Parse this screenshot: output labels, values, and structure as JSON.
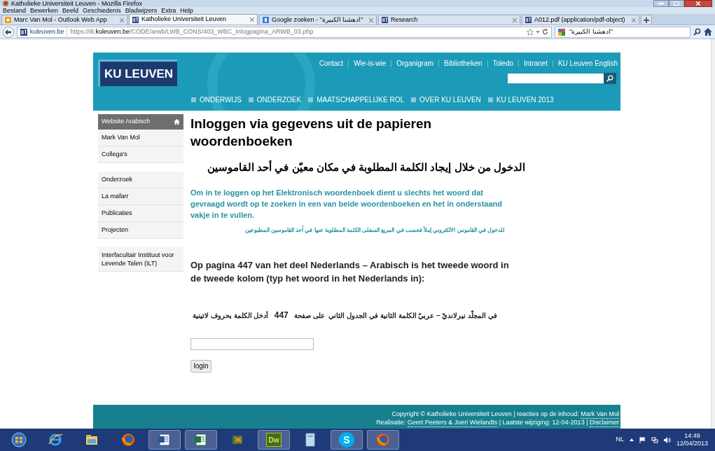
{
  "window": {
    "title": "Katholieke Universiteit Leuven - Mozilla Firefox"
  },
  "menu": [
    "Bestand",
    "Bewerken",
    "Beeld",
    "Geschiedenis",
    "Bladwijzers",
    "Extra",
    "Help"
  ],
  "tabs": [
    {
      "label": "Marc Van Mol - Outlook Web App",
      "selected": false,
      "kind": "outlook"
    },
    {
      "label": "Katholieke Universiteit Leuven",
      "selected": true,
      "kind": "site"
    },
    {
      "label": "\"ادهشنا الكبيرة\" - Google zoeken",
      "selected": false,
      "kind": "google"
    },
    {
      "label": "Research",
      "selected": false,
      "kind": "site"
    },
    {
      "label": "A012.pdf (application/pdf-object)",
      "selected": false,
      "kind": "site"
    }
  ],
  "address": {
    "domain": "kuleuven.be",
    "url_start": "https://ilt.",
    "url_bold": "kuleuven.be",
    "url_rest": "/CODE/arwb/LWB_CONS/403_WBC_Inlogpagina_ARWB_03.php"
  },
  "search": {
    "value": "\"ادهشنا الكبيرة\""
  },
  "header": {
    "logo": "KU LEUVEN",
    "top_links": [
      "Contact",
      "Wie-is-wie",
      "Organigram",
      "Bibliotheken",
      "Toledo",
      "Intranet",
      "KU Leuven English"
    ],
    "nav": [
      "ONDERWIJS",
      "ONDERZOEK",
      "MAATSCHAPPELIJKE ROL",
      "OVER KU LEUVEN",
      "KU LEUVEN 2013"
    ]
  },
  "sidebar": [
    [
      {
        "label": "Website Arabisch",
        "selected": true
      },
      {
        "label": "Mark Van Mol",
        "selected": false
      },
      {
        "label": "Collega's",
        "selected": false
      }
    ],
    [
      {
        "label": "Onderzoek",
        "selected": false
      },
      {
        "label": "La mafarr",
        "selected": false
      },
      {
        "label": "Publicaties",
        "selected": false
      },
      {
        "label": "Projecten",
        "selected": false
      }
    ],
    [
      {
        "label": "Interfacultair Instituut voor Levende Talen (ILT)",
        "selected": false
      }
    ]
  ],
  "main": {
    "title": "Inloggen via gegevens uit de papieren woordenboeken",
    "arabic_title": "الدخول من خلال إيجاد الكلمة المطلوبة في مكان معيّن في أحد القاموسين",
    "intro": "Om in te loggen op het Elektronisch woordenboek dient u slechts het woord dat gevraagd wordt op te zoeken in een van beide woordenboeken en het in onderstaand vakje in te vullen.",
    "arabic_intro": "للدخول في القاموس الالكتروني إملأ فحسب في المربع السفلى الكلمة المطلوبة عنها في أحد القاموسين المطبوعين",
    "question": "Op pagina 447 van het deel Nederlands – Arabisch is het tweede woord in de tweede kolom (typ het woord in het Nederlands in):",
    "arabic_question": "في المجلّد نيرلانديّ – عربيّ الكلمة الثانية في الجدول الثاني  على صفحة   **447**   أدخل الكلمة بحروف لاتينية",
    "button": "login"
  },
  "footer": [
    [
      {
        "text": "Copyright © Katholieke Universiteit Leuven | reacties op de inhoud: ",
        "link": false
      },
      {
        "text": "Mark Van Mol",
        "link": true
      }
    ],
    [
      {
        "text": "Realisatie: ",
        "link": false
      },
      {
        "text": "Geert Peeters & Joeri Wielandts",
        "link": true
      },
      {
        "text": " | Laatste wijziging: 12-04-2013 | ",
        "link": false
      },
      {
        "text": "Disclaimer",
        "link": true
      }
    ]
  ],
  "taskbar": {
    "apps": [
      {
        "kind": "start",
        "running": false
      },
      {
        "kind": "ie",
        "running": false
      },
      {
        "kind": "folder",
        "running": false
      },
      {
        "kind": "firefox",
        "running": false
      },
      {
        "kind": "word",
        "running": true
      },
      {
        "kind": "excel",
        "running": true
      },
      {
        "kind": "movie",
        "running": false
      },
      {
        "kind": "dw",
        "label": "Dw",
        "running": true
      },
      {
        "kind": "calc",
        "running": false
      },
      {
        "kind": "skype",
        "label": "S",
        "running": true
      },
      {
        "kind": "firefox",
        "running": true
      }
    ],
    "language": "NL",
    "time": "14:49",
    "date": "12/04/2013"
  }
}
